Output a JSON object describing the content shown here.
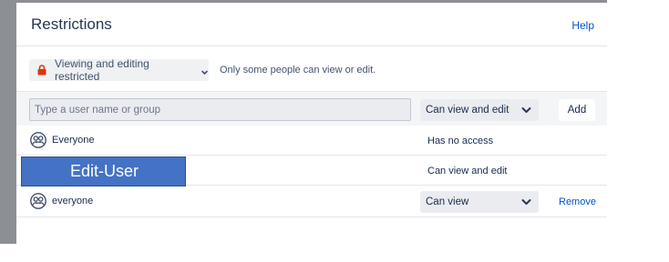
{
  "dialog": {
    "title": "Restrictions",
    "help_label": "Help"
  },
  "restriction": {
    "dropdown_label": "Viewing and editing restricted",
    "description": "Only some people can view or edit."
  },
  "add_row": {
    "placeholder": "Type a user name or group",
    "permission": "Can view and edit",
    "add_label": "Add"
  },
  "entries": [
    {
      "name": "Everyone",
      "permission": "Has no access"
    },
    {
      "name": "Edit-User",
      "permission": "Can view and edit"
    },
    {
      "name": "everyone",
      "permission": "Can view",
      "remove_label": "Remove"
    }
  ],
  "colors": {
    "link": "#0052cc",
    "lock": "#de350b",
    "overlay": "#4472c4"
  },
  "icons": [
    "lock-icon",
    "chevron-down-icon",
    "user-group-icon"
  ]
}
